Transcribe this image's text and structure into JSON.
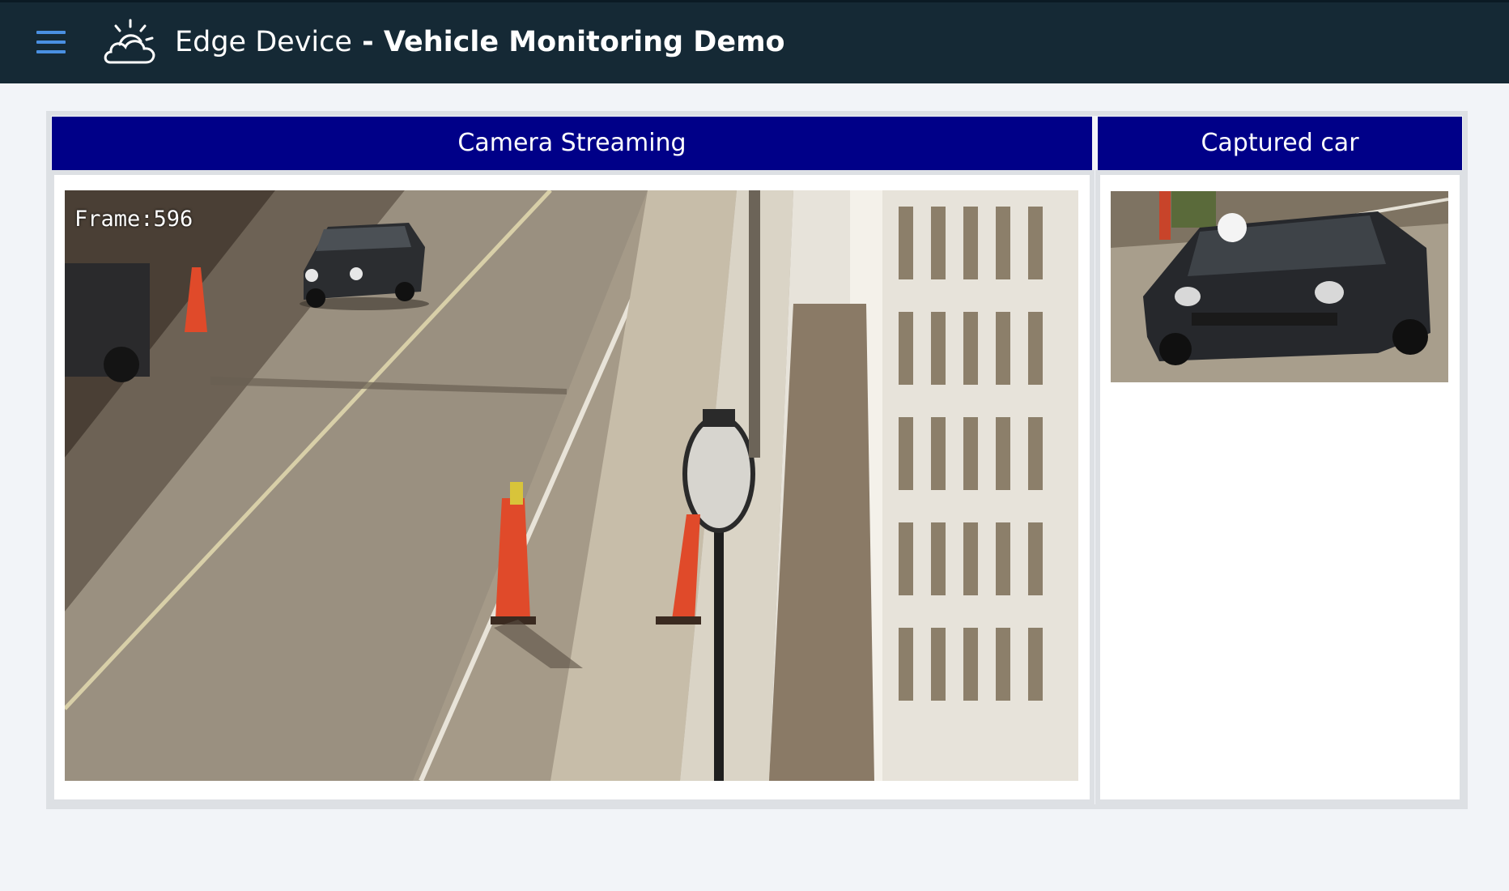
{
  "header": {
    "app_name": "Edge Device",
    "separator": " - ",
    "subtitle": "Vehicle Monitoring Demo",
    "menu_icon": "hamburger-menu-icon",
    "logo_icon": "cloud-sun-icon",
    "background_color": "#152935",
    "menu_icon_color": "#4a90e2"
  },
  "panels": {
    "camera": {
      "title": "Camera Streaming",
      "frame_label": "Frame:596"
    },
    "captured": {
      "title": "Captured car"
    },
    "header_color": "#000088"
  }
}
